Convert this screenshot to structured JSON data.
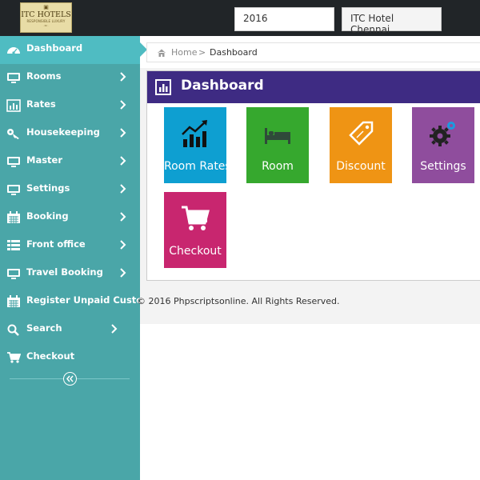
{
  "header": {
    "logo": {
      "name": "ITC HOTELS",
      "tagline": "RESPONSIBLE LUXURY",
      "fine_print": "· itc ·"
    },
    "year": "2016",
    "hotel": "ITC Hotel Chennai"
  },
  "sidebar": {
    "items": [
      {
        "label": "Dashboard",
        "icon": "dashboard-icon",
        "active": true
      },
      {
        "label": "Rooms",
        "icon": "monitor-icon"
      },
      {
        "label": "Rates",
        "icon": "bar-chart-icon"
      },
      {
        "label": "Housekeeping",
        "icon": "key-icon"
      },
      {
        "label": "Master",
        "icon": "monitor-icon"
      },
      {
        "label": "Settings",
        "icon": "monitor-icon"
      },
      {
        "label": "Booking",
        "icon": "calendar-icon"
      },
      {
        "label": "Front office",
        "icon": "list-icon"
      },
      {
        "label": "Travel Booking",
        "icon": "monitor-icon"
      },
      {
        "label": "Register Unpaid Customer",
        "icon": "calendar-icon"
      },
      {
        "label": "Search",
        "icon": "search-icon"
      },
      {
        "label": "Checkout",
        "icon": "cart-icon"
      }
    ],
    "collapse_icon": "double-chevron-left-icon"
  },
  "breadcrumb": {
    "home": "Home",
    "separator": ">",
    "current": "Dashboard"
  },
  "dashboard": {
    "title": "Dashboard",
    "tiles": [
      {
        "label": "Room Rates",
        "icon": "line-chart-icon",
        "color": "#0e9fd1"
      },
      {
        "label": "Room",
        "icon": "bed-icon",
        "color": "#36a82e"
      },
      {
        "label": "Discount",
        "icon": "tag-icon",
        "color": "#ef9414"
      },
      {
        "label": "Settings",
        "icon": "gears-icon",
        "color": "#8f4d9d"
      },
      {
        "label": "Checkout",
        "icon": "cart-icon",
        "color": "#c8266f"
      }
    ]
  },
  "footer": {
    "text": "© 2016 Phpscriptsonline. All Rights Reserved."
  },
  "colors": {
    "topbar": "#212528",
    "sidebar": "#4aa6a8",
    "sidebar_active": "#4fbcc2",
    "panel_header": "#3e2b83"
  }
}
